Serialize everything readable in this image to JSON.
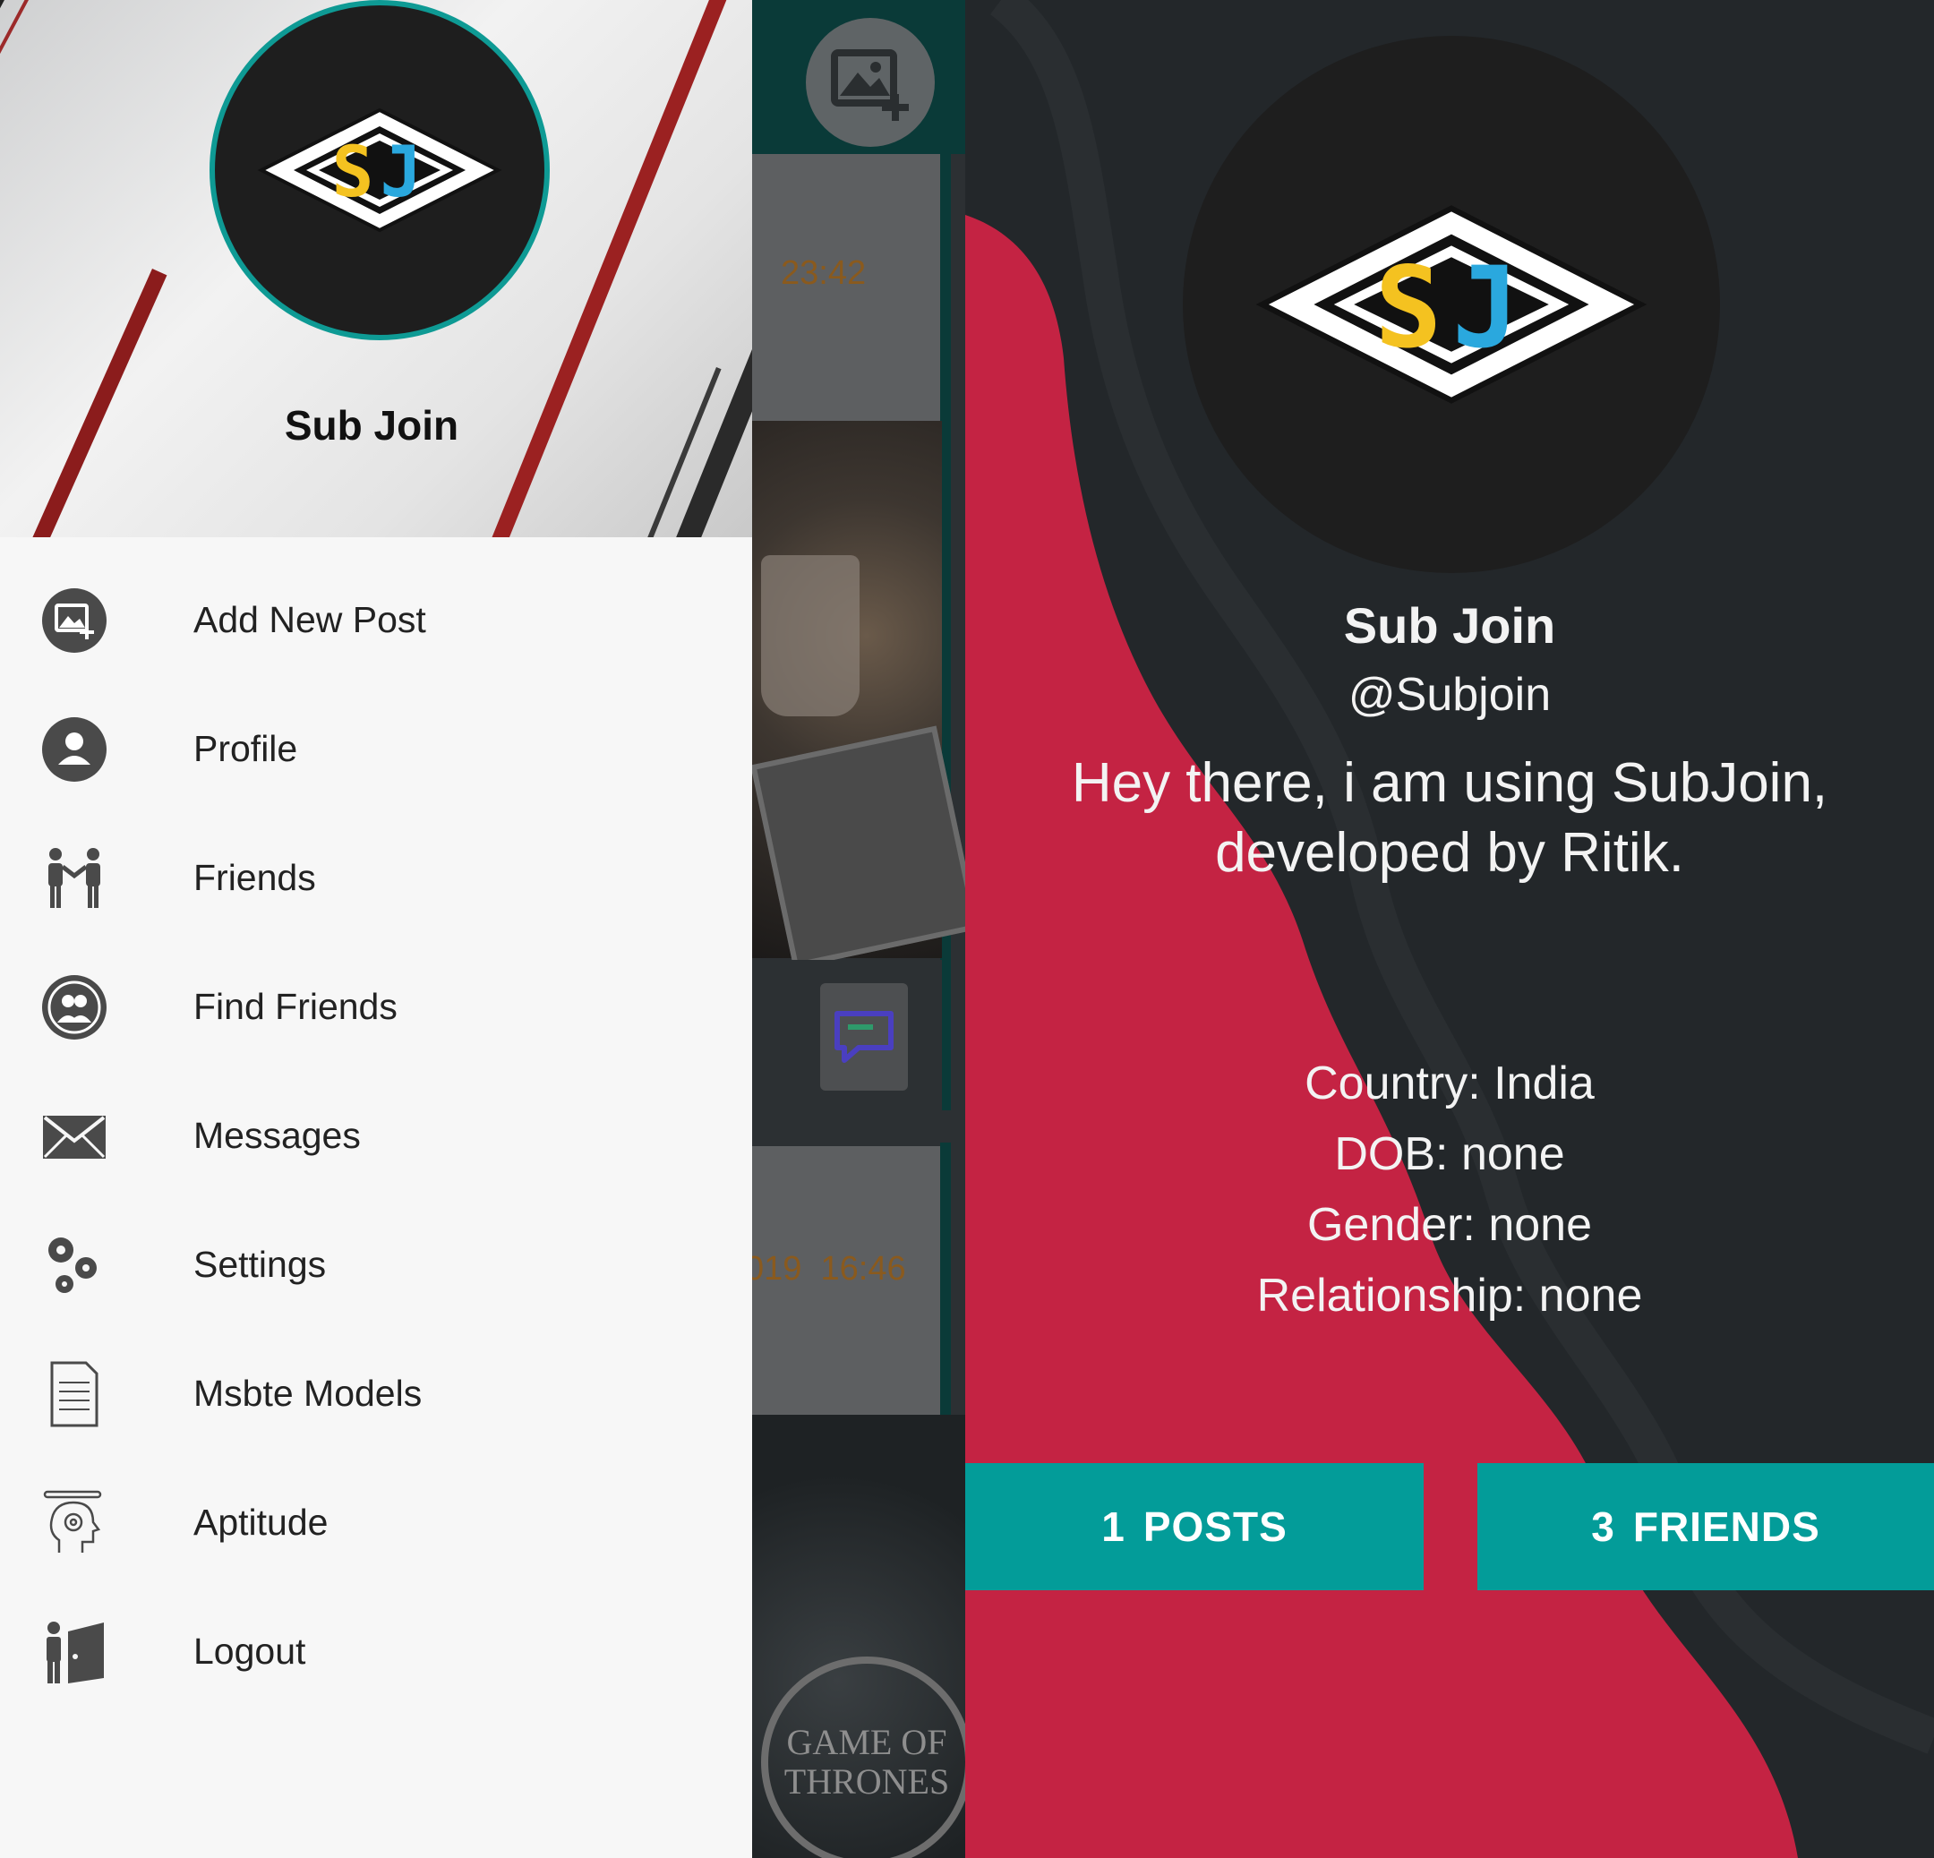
{
  "drawer": {
    "header": {
      "name": "Sub Join"
    },
    "menu_items": [
      {
        "label": "Add New Post",
        "icon": "add-photo-icon"
      },
      {
        "label": "Profile",
        "icon": "person-icon"
      },
      {
        "label": "Friends",
        "icon": "friends-icon"
      },
      {
        "label": "Find Friends",
        "icon": "find-friends-icon"
      },
      {
        "label": "Messages",
        "icon": "envelope-icon"
      },
      {
        "label": "Settings",
        "icon": "gears-icon"
      },
      {
        "label": "Msbte Models",
        "icon": "document-icon"
      },
      {
        "label": "Aptitude",
        "icon": "brain-head-icon"
      },
      {
        "label": "Logout",
        "icon": "logout-door-icon"
      }
    ]
  },
  "feed": {
    "post1_time": "23:42",
    "post2_time": "019  16:46",
    "medallion_text": "GAME OF THRONES"
  },
  "logo": {
    "letters": "SJ"
  },
  "profile": {
    "name": "Sub Join",
    "username": "@Subjoin",
    "status_line1": "Hey there, i am using SubJoin,",
    "status_line2": "developed by Ritik.",
    "country": "Country: India",
    "dob": "DOB: none",
    "gender": "Gender: none",
    "relationship": "Relationship: none",
    "posts_count": "1",
    "posts_label": "POSTS",
    "friends_count": "3",
    "friends_label": "FRIENDS"
  },
  "colors": {
    "teal": "#039c99",
    "crimson": "#c42343",
    "dark": "#23272a",
    "logo_yellow": "#f4c220",
    "logo_blue": "#2aa8de"
  }
}
